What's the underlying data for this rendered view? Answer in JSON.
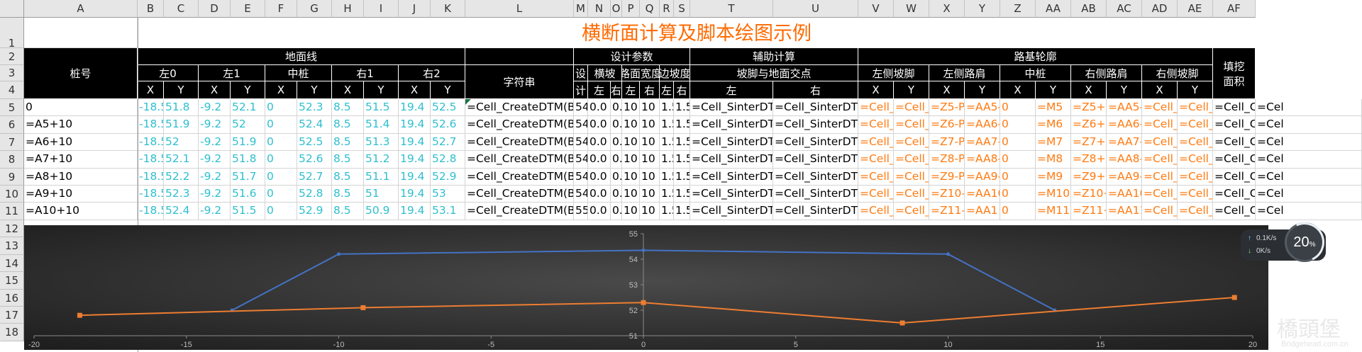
{
  "columns": [
    "A",
    "B",
    "C",
    "D",
    "E",
    "F",
    "G",
    "H",
    "I",
    "J",
    "K",
    "L",
    "M",
    "N",
    "O",
    "P",
    "Q",
    "R",
    "S",
    "T",
    "U",
    "V",
    "W",
    "X",
    "Y",
    "Z",
    "AA",
    "AB",
    "AC",
    "AD",
    "AE",
    "AF"
  ],
  "rows": [
    "1",
    "2",
    "3",
    "4",
    "5",
    "6",
    "7",
    "8",
    "9",
    "10",
    "11",
    "12",
    "13",
    "14",
    "15",
    "16",
    "17",
    "18"
  ],
  "title": "横断面计算及脚本绘图示例",
  "header": {
    "zhuanghao": "桩号",
    "dimianxian": "地面线",
    "sheji": "设计参数",
    "fuzhu": "辅助计算",
    "lujilunkuo": "路基轮廓",
    "tianwa_1": "填挖",
    "tianwa_2": "面积",
    "zuo0": "左0",
    "zuo1": "左1",
    "zhongzhuang": "中桩",
    "you1": "右1",
    "you2": "右2",
    "zifuchuan": "字符串",
    "she": "设",
    "ji": "计",
    "hengpo": "横坡",
    "zuo": "左",
    "you": "右",
    "lumiankuandu": "路面宽度",
    "bianpodu": "边坡度",
    "pojiao_dimian": "坡脚与地面交点",
    "zuoce_pojiao": "左侧坡脚",
    "zuoce_lujian": "左侧路肩",
    "youce_lujian": "右侧路肩",
    "youce_pojiao": "右侧坡脚",
    "x": "X",
    "y": "Y"
  },
  "data_rows": [
    {
      "a": "0",
      "ground": [
        "-18.5",
        "51.8",
        "-9.2",
        "52.1",
        "0",
        "52.3",
        "8.5",
        "51.5",
        "19.4",
        "52.5"
      ],
      "l": "=Cell_CreateDTM(B",
      "m": "54.",
      "n": "0.0",
      "o": "0.0",
      "p": "10",
      "q": "10",
      "r": "1.5",
      "s": "1.5",
      "t": "=Cell_SinterDTM",
      "u": "=Cell_SinterDTM",
      "v": "=Cell_",
      "w": "=Cell_",
      "x": "=Z5-P",
      "y": "=AA5-",
      "z": "0",
      "aa": "=M5",
      "ab": "=Z5+Q",
      "ac": "=AA5-",
      "ad": "=Cell_G",
      "ae": "=Cell_G",
      "af": "=Cell_C",
      "ag": "=Cel"
    },
    {
      "a": "=A5+10",
      "ground": [
        "-18.5",
        "51.9",
        "-9.2",
        "52",
        "0",
        "52.4",
        "8.5",
        "51.4",
        "19.4",
        "52.6"
      ],
      "l": "=Cell_CreateDTM(B",
      "m": "54.",
      "n": "0.0",
      "o": "0.0",
      "p": "10",
      "q": "10",
      "r": "1.5",
      "s": "1.5",
      "t": "=Cell_SinterDTM",
      "u": "=Cell_SinterDTM",
      "v": "=Cell_",
      "w": "=Cell_",
      "x": "=Z6-P",
      "y": "=AA6-",
      "z": "0",
      "aa": "=M6",
      "ab": "=Z6+Q",
      "ac": "=AA6-",
      "ad": "=Cell_G",
      "ae": "=Cell_G",
      "af": "=Cell_C",
      "ag": "=Cel"
    },
    {
      "a": "=A6+10",
      "ground": [
        "-18.5",
        "52",
        "-9.2",
        "51.9",
        "0",
        "52.5",
        "8.5",
        "51.3",
        "19.4",
        "52.7"
      ],
      "l": "=Cell_CreateDTM(B",
      "m": "54.",
      "n": "0.0",
      "o": "0.0",
      "p": "10",
      "q": "10",
      "r": "1.5",
      "s": "1.5",
      "t": "=Cell_SinterDTM",
      "u": "=Cell_SinterDTM",
      "v": "=Cell_",
      "w": "=Cell_",
      "x": "=Z7-P",
      "y": "=AA7-",
      "z": "0",
      "aa": "=M7",
      "ab": "=Z7+Q",
      "ac": "=AA7-",
      "ad": "=Cell_G",
      "ae": "=Cell_G",
      "af": "=Cell_C",
      "ag": "=Cel"
    },
    {
      "a": "=A7+10",
      "ground": [
        "-18.5",
        "52.1",
        "-9.2",
        "51.8",
        "0",
        "52.6",
        "8.5",
        "51.2",
        "19.4",
        "52.8"
      ],
      "l": "=Cell_CreateDTM(B",
      "m": "54.",
      "n": "0.0",
      "o": "0.0",
      "p": "10",
      "q": "10",
      "r": "1.5",
      "s": "1.5",
      "t": "=Cell_SinterDTM",
      "u": "=Cell_SinterDTM",
      "v": "=Cell_",
      "w": "=Cell_",
      "x": "=Z8-P",
      "y": "=AA8-",
      "z": "0",
      "aa": "=M8",
      "ab": "=Z8+Q",
      "ac": "=AA8-",
      "ad": "=Cell_G",
      "ae": "=Cell_G",
      "af": "=Cell_C",
      "ag": "=Cel"
    },
    {
      "a": "=A8+10",
      "ground": [
        "-18.5",
        "52.2",
        "-9.2",
        "51.7",
        "0",
        "52.7",
        "8.5",
        "51.1",
        "19.4",
        "52.9"
      ],
      "l": "=Cell_CreateDTM(B",
      "m": "54.",
      "n": "0.0",
      "o": "0.0",
      "p": "10",
      "q": "10",
      "r": "1.5",
      "s": "1.5",
      "t": "=Cell_SinterDTM",
      "u": "=Cell_SinterDTM",
      "v": "=Cell_",
      "w": "=Cell_",
      "x": "=Z9-P",
      "y": "=AA9-",
      "z": "0",
      "aa": "=M9",
      "ab": "=Z9+Q",
      "ac": "=AA9-",
      "ad": "=Cell_G",
      "ae": "=Cell_G",
      "af": "=Cell_C",
      "ag": "=Cel"
    },
    {
      "a": "=A9+10",
      "ground": [
        "-18.5",
        "52.3",
        "-9.2",
        "51.6",
        "0",
        "52.8",
        "8.5",
        "51",
        "19.4",
        "53"
      ],
      "l": "=Cell_CreateDTM(B",
      "m": "54.",
      "n": "0.0",
      "o": "0.0",
      "p": "10",
      "q": "10",
      "r": "1.5",
      "s": "1.5",
      "t": "=Cell_SinterDTM",
      "u": "=Cell_SinterDTM",
      "v": "=Cell_",
      "w": "=Cell_",
      "x": "=Z10-",
      "y": "=AA10",
      "z": "0",
      "aa": "=M10",
      "ab": "=Z10+Q",
      "ac": "=AA10-",
      "ad": "=Cell_G",
      "ae": "=Cell_G",
      "af": "=Cell_C",
      "ag": "=Cel"
    },
    {
      "a": "=A10+10",
      "ground": [
        "-18.5",
        "52.4",
        "-9.2",
        "51.5",
        "0",
        "52.9",
        "8.5",
        "50.9",
        "19.4",
        "53.1"
      ],
      "l": "=Cell_CreateDTM(B",
      "m": "55",
      "n": "0.0",
      "o": "0.0",
      "p": "10",
      "q": "10",
      "r": "1.5",
      "s": "1.5",
      "t": "=Cell_SinterDTM",
      "u": "=Cell_SinterDTM",
      "v": "=Cell_",
      "w": "=Cell_",
      "x": "=Z11-",
      "y": "=AA1",
      "z": "0",
      "aa": "=M11",
      "ab": "=Z11+Q",
      "ac": "=AA11-",
      "ad": "=Cell_G",
      "ae": "=Cell_G",
      "af": "=Cell_C",
      "ag": "=Cel"
    }
  ],
  "chart_data": {
    "type": "scatter",
    "title": "",
    "xlabel": "",
    "ylabel": "",
    "xlim": [
      -20,
      20
    ],
    "ylim": [
      51,
      55
    ],
    "x_ticks": [
      "-20",
      "-15",
      "-10",
      "-5",
      "0",
      "5",
      "10",
      "15",
      "20"
    ],
    "y_ticks": [
      "51",
      "52",
      "53",
      "54",
      "55"
    ],
    "series": [
      {
        "color": "#4472c4",
        "points": [
          [
            -13.5,
            52
          ],
          [
            -10,
            54.2
          ],
          [
            0,
            54.35
          ],
          [
            10,
            54.2
          ],
          [
            13.5,
            52
          ]
        ]
      },
      {
        "color": "#ed7d31",
        "points": [
          [
            -18.5,
            51.8
          ],
          [
            -9.2,
            52.1
          ],
          [
            0,
            52.3
          ],
          [
            8.5,
            51.5
          ],
          [
            19.4,
            52.5
          ]
        ]
      }
    ],
    "grid": false,
    "legend": "none",
    "background": "#2b2b2b"
  },
  "tray": {
    "speed_up": "0.1K/s",
    "speed_down": "0K/s",
    "gauge_value": "20",
    "gauge_unit": "%"
  },
  "watermark": {
    "main": "橋頭堡",
    "sub": "Bridgehead.com.cn"
  },
  "colors": {
    "title": "#ff6a00",
    "cyan": "#2fbfcf",
    "orange": "#ff7a10",
    "blue_series": "#4472c4",
    "orange_series": "#ed7d31"
  }
}
